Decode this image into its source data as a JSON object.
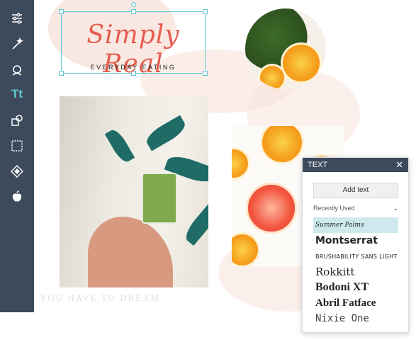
{
  "toolbar": {
    "items": [
      {
        "name": "sliders-icon"
      },
      {
        "name": "magic-wand-icon"
      },
      {
        "name": "portrait-icon"
      },
      {
        "name": "text-tool-icon",
        "label": "Tt"
      },
      {
        "name": "shapes-icon"
      },
      {
        "name": "frame-icon"
      },
      {
        "name": "texture-icon"
      },
      {
        "name": "apple-icon"
      }
    ],
    "active": "text-tool-icon"
  },
  "canvas": {
    "title": "Simply Real",
    "subtitle": "EVERYDAY EATING",
    "background_text": "YOU HAVE TO DREAM",
    "accent_color": "#e65c4f"
  },
  "text_panel": {
    "header": "TEXT",
    "close_label": "✕",
    "add_text_label": "Add text",
    "recent_label": "Recently Used",
    "recent_chevron": "⌄",
    "fonts": [
      {
        "label": "Summer Palms",
        "selected": true
      },
      {
        "label": "Montserrat"
      },
      {
        "label": "BRUSHABILITY SANS LIGHT"
      },
      {
        "label": "Rokkitt"
      },
      {
        "label": "Bodoni XT"
      },
      {
        "label": "Abril Fatface"
      },
      {
        "label": "Nixie One"
      }
    ]
  },
  "colors": {
    "toolbar_bg": "#3d4a5c",
    "highlight": "#5ec6d4",
    "selected_font_bg": "#cde9ee"
  }
}
